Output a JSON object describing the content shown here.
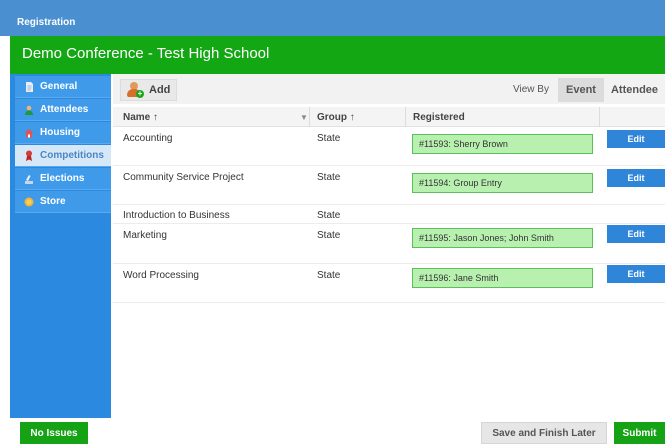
{
  "window": {
    "title": "Registration"
  },
  "header": {
    "conference_title": "Demo Conference - Test High School"
  },
  "sidebar": {
    "items": [
      {
        "label": "General",
        "icon": "document-icon",
        "active": false
      },
      {
        "label": "Attendees",
        "icon": "person-icon",
        "active": false
      },
      {
        "label": "Housing",
        "icon": "house-icon",
        "active": false
      },
      {
        "label": "Competitions",
        "icon": "ribbon-icon",
        "active": true
      },
      {
        "label": "Elections",
        "icon": "vote-icon",
        "active": false
      },
      {
        "label": "Store",
        "icon": "coin-icon",
        "active": false
      }
    ]
  },
  "toolbar": {
    "add_label": "Add",
    "view_by_label": "View By",
    "view_tabs": [
      "Event",
      "Attendee"
    ]
  },
  "table": {
    "columns": [
      "Name ↑",
      "Group ↑",
      "Registered"
    ],
    "edit_label": "Edit",
    "rows": [
      {
        "name": "Accounting",
        "group": "State",
        "registered": "#11593: Sherry Brown"
      },
      {
        "name": "Community Service Project",
        "group": "State",
        "registered": "#11594: Group Entry"
      },
      {
        "name": "Introduction to Business",
        "group": "State",
        "registered": ""
      },
      {
        "name": "Marketing",
        "group": "State",
        "registered": "#11595: Jason Jones; John Smith"
      },
      {
        "name": "Word Processing",
        "group": "State",
        "registered": "#11596: Jane Smith"
      }
    ]
  },
  "footer": {
    "status_label": "No Issues",
    "save_label": "Save and Finish Later",
    "submit_label": "Submit"
  },
  "colors": {
    "brand_blue": "#4a8fcf",
    "brand_green": "#13a813",
    "sidebar_blue": "#2b8ae0",
    "edit_blue": "#2f86d8",
    "registered_green": "#b8f0b0"
  }
}
